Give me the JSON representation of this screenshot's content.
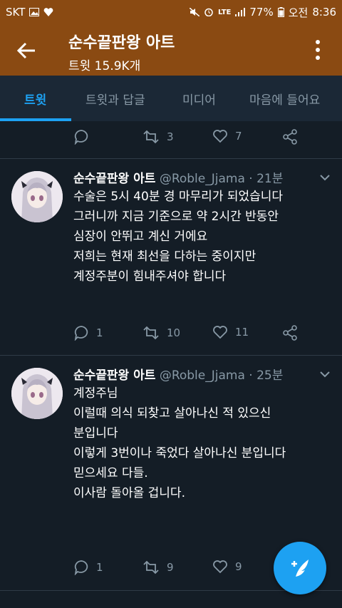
{
  "status_bar": {
    "carrier": "SKT",
    "network": "LTE",
    "battery": "77%",
    "ampm": "오전",
    "time": "8:36",
    "icons": [
      "image-icon",
      "heart-icon",
      "mute-icon",
      "alarm-icon",
      "signal-icon",
      "battery-icon"
    ]
  },
  "header": {
    "title": "순수끝판왕 아트",
    "subtitle": "트윗 15.9K개",
    "background": "#8a4a12"
  },
  "tabs": [
    {
      "label": "트윗",
      "active": true
    },
    {
      "label": "트윗과 답글",
      "active": false
    },
    {
      "label": "미디어",
      "active": false
    },
    {
      "label": "마음에 들어요",
      "active": false
    }
  ],
  "prev_tweet_actions": {
    "reply": "",
    "retweet": "3",
    "like": "7"
  },
  "tweets": [
    {
      "name": "순수끝판왕 아트",
      "handle": "@Roble_Jjama",
      "time": "· 21분",
      "lines": [
        "수술은 5시 40분 경 마무리가 되었습니다",
        "",
        "그러니까 지금 기준으로 약 2시간 반동안",
        "심장이 안뛰고 계신 거에요",
        "",
        "저희는 현재 최선을 다하는 중이지만",
        "계정주분이 힘내주셔야 합니다"
      ],
      "reply": "1",
      "retweet": "10",
      "like": "11"
    },
    {
      "name": "순수끝판왕 아트",
      "handle": "@Roble_Jjama",
      "time": "· 25분",
      "lines": [
        "계정주님",
        "",
        "이럴때 의식 되찾고 살아나신 적 있으신",
        "분입니다",
        "",
        "이렇게 3번이나 죽었다 살아나신 분입니다",
        "",
        "믿으세요 다들.",
        "이사람 돌아올 겁니다."
      ],
      "reply": "1",
      "retweet": "9",
      "like": "9"
    }
  ],
  "colors": {
    "accent": "#1da1f2",
    "background": "#141d26",
    "muted": "#8899a6"
  }
}
